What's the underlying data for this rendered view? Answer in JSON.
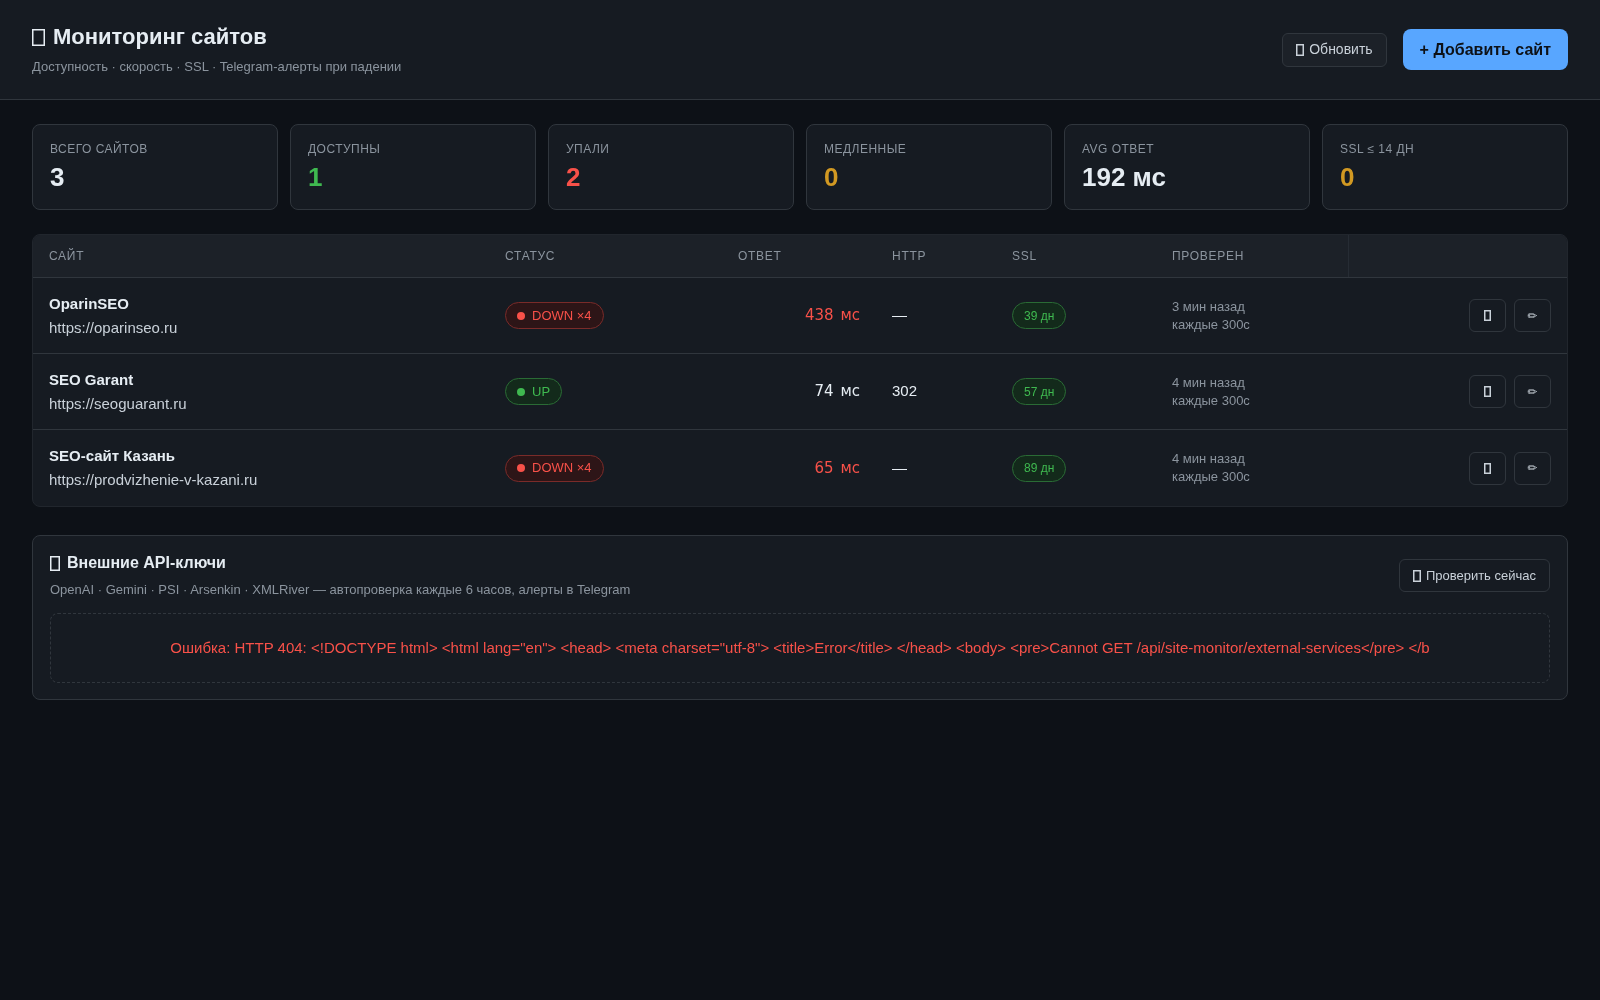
{
  "header": {
    "title": "Мониторинг сайтов",
    "subtitle": "Доступность · скорость · SSL · Telegram-алерты при падении",
    "buttons": [
      {
        "label": "Обновить",
        "kind": "secondary"
      },
      {
        "label": "+ Добавить сайт",
        "kind": "primary"
      }
    ]
  },
  "stats": [
    {
      "label": "ВСЕГО САЙТОВ",
      "value": "3",
      "color": "#e6edf3"
    },
    {
      "label": "ДОСТУПНЫ",
      "value": "1",
      "color": "#3fb950"
    },
    {
      "label": "УПАЛИ",
      "value": "2",
      "color": "#f85149"
    },
    {
      "label": "МЕДЛЕННЫЕ",
      "value": "0",
      "color": "#d29922"
    },
    {
      "label": "AVG ОТВЕТ",
      "value": "192 мс",
      "color": "#e6edf3"
    },
    {
      "label": "SSL ≤ 14 ДН",
      "value": "0",
      "color": "#d29922"
    }
  ],
  "table": {
    "columns": [
      "САЙТ",
      "СТАТУС",
      "ОТВЕТ",
      "HTTP",
      "SSL",
      "ПРОВЕРЕН"
    ],
    "rows": [
      {
        "name": "OparinSEO",
        "url": "https://oparinseo.ru",
        "status": {
          "kind": "down",
          "label": "DOWN ×4"
        },
        "response": {
          "value": "438",
          "unit": "мс"
        },
        "http": "—",
        "ssl": "39 дн",
        "checked": "3 мин назад",
        "interval": "каждые 300с",
        "edit_label": "✏"
      },
      {
        "name": "SEO Garant",
        "url": "https://seoguarant.ru",
        "status": {
          "kind": "up",
          "label": "UP"
        },
        "response": {
          "value": "74",
          "unit": "мс"
        },
        "http": "302",
        "ssl": "57 дн",
        "checked": "4 мин назад",
        "interval": "каждые 300с",
        "edit_label": "✏"
      },
      {
        "name": "SEO-сайт Казань",
        "url": "https://prodvizhenie-v-kazani.ru",
        "status": {
          "kind": "down",
          "label": "DOWN ×4"
        },
        "response": {
          "value": "65",
          "unit": "мс"
        },
        "http": "—",
        "ssl": "89 дн",
        "checked": "4 мин назад",
        "interval": "каждые 300с",
        "edit_label": "✏"
      }
    ]
  },
  "api_keys": {
    "title": "Внешние API-ключи",
    "subtitle": "OpenAI · Gemini · PSI · Arsenkin · XMLRiver — автопроверка каждые 6 часов, алерты в Telegram",
    "button": "Проверить сейчас",
    "error": "Ошибка: HTTP 404: <!DOCTYPE html> <html lang=\"en\"> <head> <meta charset=\"utf-8\"> <title>Error</title> </head> <body> <pre>Cannot GET /api/site-monitor/external-services</pre> </b"
  }
}
